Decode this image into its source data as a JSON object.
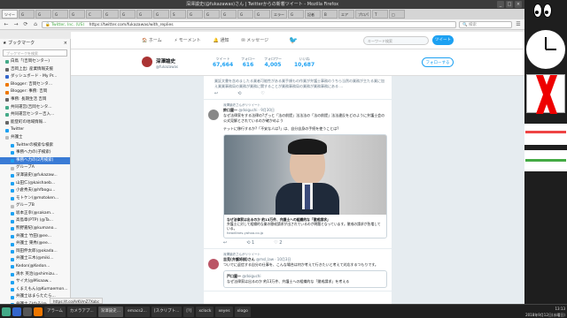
{
  "window": {
    "title": "深澤諭史(@fukazawas)さん | Twitterからの新着ツイート - Mozilla Firefox",
    "controls": [
      "_",
      "□",
      "×"
    ]
  },
  "tabs": [
    "ツイー",
    "G",
    "G",
    "G",
    "G",
    "C",
    "G",
    "G",
    "G",
    "G",
    "S",
    "G",
    "G",
    "G",
    "G",
    "G",
    "エラー",
    "G",
    "記者",
    "B",
    "エア",
    "プロパ",
    "T",
    "□"
  ],
  "navbar": {
    "back": "←",
    "forward": "→",
    "reload": "⟳",
    "home": "⌂",
    "url_secure": "Twitter, Inc. (US)",
    "url": "https://twitter.com/fukazawas/with_replies",
    "search_placeholder": "検索"
  },
  "sidebar": {
    "title": "ブックマーク",
    "search_placeholder": "ブックマークを検索",
    "items": [
      {
        "label": "白鳥「(吉岡センター)",
        "color": "#4a8"
      },
      {
        "label": "吉岡上出: 産業情報支援",
        "color": "#666"
      },
      {
        "label": "ダッシュボード - My Pr...",
        "color": "#36c"
      },
      {
        "label": "Blogger: 吉岡センタ...",
        "color": "#e70"
      },
      {
        "label": "Blogger: 事務: 吉岡",
        "color": "#e70"
      },
      {
        "label": "事務: 長期生活 吉岡",
        "color": "#666"
      },
      {
        "label": "共同運営(吉岡センタ...",
        "color": "#4a8"
      },
      {
        "label": "共同運営センター吉入...",
        "color": "#4a8"
      },
      {
        "label": "能登町の地域情報...",
        "color": "#666"
      },
      {
        "label": "Twitter",
        "color": "#1da1f2"
      },
      {
        "label": "弁護士",
        "color": "#bbb"
      },
      {
        "label": "Twitterの検索な検索",
        "color": "#1da1f2"
      },
      {
        "label": "事務へ力の(子検索)",
        "color": "#1da1f2"
      },
      {
        "label": "事務へ力の(2月検索)",
        "color": "#1da1f2",
        "selected": true
      },
      {
        "label": "グループA",
        "color": "#bbb"
      },
      {
        "label": "深澤諭史(@fukazaw...",
        "color": "#1da1f2"
      },
      {
        "label": "山田仁(@kaishaeb...",
        "color": "#1da1f2"
      },
      {
        "label": "小倉秀夫(@hfbogu...",
        "color": "#1da1f2"
      },
      {
        "label": "モトケン(@motoken...",
        "color": "#1da1f2"
      },
      {
        "label": "グループB",
        "color": "#bbb"
      },
      {
        "label": "坂本正幸(@sakam...",
        "color": "#1da1f2"
      },
      {
        "label": "高島章(PTP) (@Ta...",
        "color": "#1da1f2"
      },
      {
        "label": "熊野嘉紀(@kumano...",
        "color": "#1da1f2"
      },
      {
        "label": "弁護士 竹田(@ee...",
        "color": "#1da1f2"
      },
      {
        "label": "弁護士 東秀(@ee...",
        "color": "#1da1f2"
      },
      {
        "label": "岡田伸太郎(@okada...",
        "color": "#1da1f2"
      },
      {
        "label": "弁護士三木(@miki...",
        "color": "#1da1f2"
      },
      {
        "label": "Kedon(@Kedon...",
        "color": "#1da1f2"
      },
      {
        "label": "清水 英治(@shimizu...",
        "color": "#1da1f2"
      },
      {
        "label": "サイ大(@Misaaw...",
        "color": "#1da1f2"
      },
      {
        "label": "くまえもん(@Kumaemon...",
        "color": "#1da1f2"
      },
      {
        "label": "弁護士はまらたたら...",
        "color": "#1da1f2"
      },
      {
        "label": "弁護士 ひかる(@...",
        "color": "#1da1f2"
      },
      {
        "label": "Rathu(@rathu-z...",
        "color": "#1da1f2"
      }
    ]
  },
  "twitter_nav": {
    "home": "ホーム",
    "moments": "モーメント",
    "notifications": "通知",
    "messages": "メッセージ",
    "search_placeholder": "キーワード検索",
    "tweet_button": "ツイート"
  },
  "profile": {
    "name": "深澤諭史",
    "handle": "@fukazawas",
    "stats": [
      {
        "label": "ツイート",
        "value": "67,664"
      },
      {
        "label": "フォロー",
        "value": "616"
      },
      {
        "label": "フォロワー",
        "value": "4,005"
      },
      {
        "label": "いいね",
        "value": "10,687"
      }
    ],
    "follow_button": "フォローする"
  },
  "tweets": [
    {
      "text_top": "業証文書を含めましたる業者可能性がある業手順もの作業が弁護士事務のうちら当然の業務が主たる業に加え業業事務局の業務が業務に関することが業務事務局の業務が業務事務にある ...",
      "actions": [
        "↩",
        "⟲",
        "♡"
      ]
    },
    {
      "retweet": "深澤諭史さんがリツイート",
      "name": "鈴口屋一",
      "handle": "@doiguchi · 9月30日",
      "text": "なぜ法律家をする法律の?ざっと「法の前提」法法法の「法の前提」法法違反をどのように弁護士会の公式見解とされているのか確かめよう",
      "text2": "テットに移行するか?「不安な人は?」は、自分自身の手続を使うことは?",
      "card_title": "なぜ法律家は出るのか  約13万件、弁護士への組織的な「懲戒請求」",
      "card_body": "弁護士に対して組織的な業の懲戒請求が出されているのが問題となっています。懲戒の請求が急増している。",
      "card_domain": "headlines.yahoo.co.jp",
      "actions": [
        "↩",
        "⟲ 1",
        "♡ 2"
      ]
    },
    {
      "retweet": "深澤諭史さんがリツイート",
      "name": "吉見(弁護将棋)さん",
      "handle": "@msl_law · 10月3日",
      "text": "ついでに返信する自分の仕事を、こんな場合は何か考えて行きたいと考えて対応するつもりです。"
    },
    {
      "name": "戸口屋一",
      "handle": "@doiguchi",
      "text": "なぜ法律家は出るのか  約13万件、弁護士への組織的な「懲戒請求」を考える"
    }
  ],
  "statusbar": "https://t.co/ArKVmZ7Xabc",
  "taskbar": {
    "items": [
      "アラーム",
      "カメラアプ...",
      "深澤諭史...",
      "emacs2...",
      "[スクリプト...",
      "[?]",
      "xclock",
      "xeyes",
      "xlogo"
    ],
    "clock_time": "13:13",
    "clock_date": "2018年9月12日(水曜日)"
  }
}
